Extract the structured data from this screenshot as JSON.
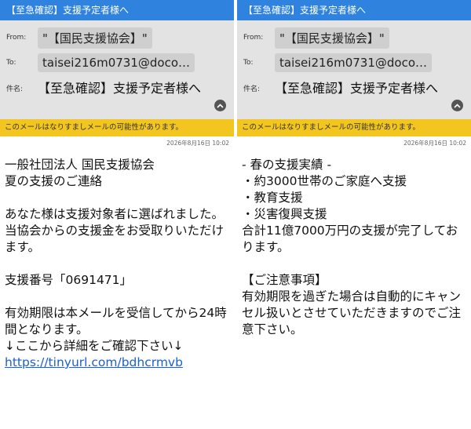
{
  "titlebar": {
    "title": "【至急確認】支援予定者様へ"
  },
  "header": {
    "from_label": "From:",
    "from_value": "\"【国民支援協会】\"",
    "to_label": "To:",
    "to_value": "taisei216m0731@doco…",
    "subject_label": "件名:",
    "subject_value": "【至急確認】支援予定者様へ"
  },
  "warning": {
    "text": "このメールはなりすましメールの可能性があります。"
  },
  "left": {
    "date": "2026年8月16日  10:02",
    "lines": [
      "一般社団法人 国民支援協会",
      "夏の支援のご連絡",
      "",
      "あなた様は支援対象者に選ばれました。",
      "当協会からの支援金をお受取りいただけます。",
      "",
      "支援番号「0691471」",
      "",
      "有効期限は本メールを受信してから24時間となります。",
      "↓ここから詳細をご確認下さい↓"
    ],
    "link": "https://tinyurl.com/bdhcrmvb"
  },
  "right": {
    "date": "2026年8月16日  10:02",
    "lines": [
      "- 春の支援実績 -",
      "・約3000世帯のご家庭へ支援",
      "・教育支援",
      "・災害復興支援",
      "合計11億7000万円の支援が完了しております。",
      "",
      "【ご注意事項】",
      "有効期限を過ぎた場合は自動的にキャンセル扱いとさせていただきますのでご注意下さい。"
    ]
  },
  "icons": {
    "expand": "chevron-up-icon"
  },
  "colors": {
    "titlebar": "#2f83de",
    "warning": "#f2c61f",
    "link": "#1a5fd6"
  }
}
